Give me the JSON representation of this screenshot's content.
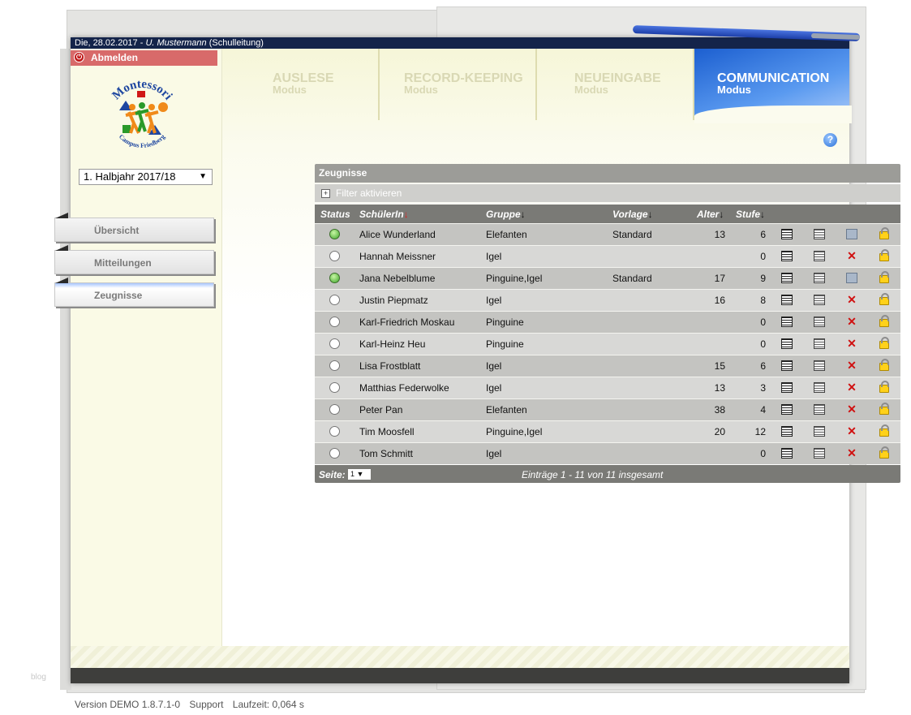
{
  "topbar": {
    "date": "Die, 28.02.2017 - ",
    "user": "U. Mustermann",
    "role": " (Schulleitung)"
  },
  "sidebar": {
    "logout_label": "Abmelden",
    "logo": {
      "name": "Montessori",
      "sub": "Campus Friedberg"
    },
    "semester_select": "1. Halbjahr 2017/18",
    "nav": [
      {
        "label": "Übersicht"
      },
      {
        "label": "Mitteilungen"
      },
      {
        "label": "Zeugnisse"
      }
    ]
  },
  "tabs": [
    {
      "title": "AUSLESE",
      "sub": "Modus"
    },
    {
      "title": "RECORD-KEEPING",
      "sub": "Modus"
    },
    {
      "title": "NEUEINGABE",
      "sub": "Modus"
    },
    {
      "title": "COMMUNICATION",
      "sub": "Modus"
    }
  ],
  "help_label": "?",
  "panel": {
    "title": "Zeugnisse",
    "filter_label": "Filter aktivieren",
    "columns": {
      "status": "Status",
      "student": "SchülerIn",
      "group": "Gruppe",
      "template": "Vorlage",
      "age": "Alter",
      "level": "Stufe"
    },
    "rows": [
      {
        "status": "green",
        "name": "Alice Wunderland",
        "group": "Elefanten",
        "template": "Standard",
        "age": "13",
        "level": "6"
      },
      {
        "status": "empty",
        "name": "Hannah Meissner",
        "group": "Igel",
        "template": "",
        "age": "",
        "level": "0"
      },
      {
        "status": "green",
        "name": "Jana Nebelblume",
        "group": "Pinguine,Igel",
        "template": "Standard",
        "age": "17",
        "level": "9"
      },
      {
        "status": "empty",
        "name": "Justin Piepmatz",
        "group": "Igel",
        "template": "",
        "age": "16",
        "level": "8"
      },
      {
        "status": "empty",
        "name": "Karl-Friedrich Moskau",
        "group": "Pinguine",
        "template": "",
        "age": "",
        "level": "0"
      },
      {
        "status": "empty",
        "name": "Karl-Heinz Heu",
        "group": "Pinguine",
        "template": "",
        "age": "",
        "level": "0"
      },
      {
        "status": "empty",
        "name": "Lisa Frostblatt",
        "group": "Igel",
        "template": "",
        "age": "15",
        "level": "6"
      },
      {
        "status": "empty",
        "name": "Matthias Federwolke",
        "group": "Igel",
        "template": "",
        "age": "13",
        "level": "3"
      },
      {
        "status": "empty",
        "name": "Peter Pan",
        "group": "Elefanten",
        "template": "",
        "age": "38",
        "level": "4"
      },
      {
        "status": "empty",
        "name": "Tim Moosfell",
        "group": "Pinguine,Igel",
        "template": "",
        "age": "20",
        "level": "12"
      },
      {
        "status": "empty",
        "name": "Tom Schmitt",
        "group": "Igel",
        "template": "",
        "age": "",
        "level": "0"
      }
    ],
    "footer": {
      "page_label": "Seite:",
      "page_value": "1",
      "info": "Einträge 1 - 11 von 11 insgesamt"
    }
  },
  "footer": {
    "version": "Version DEMO 1.8.7.1-0",
    "support": "Support",
    "runtime": "Laufzeit: 0,064 s"
  },
  "watermark": "blog"
}
